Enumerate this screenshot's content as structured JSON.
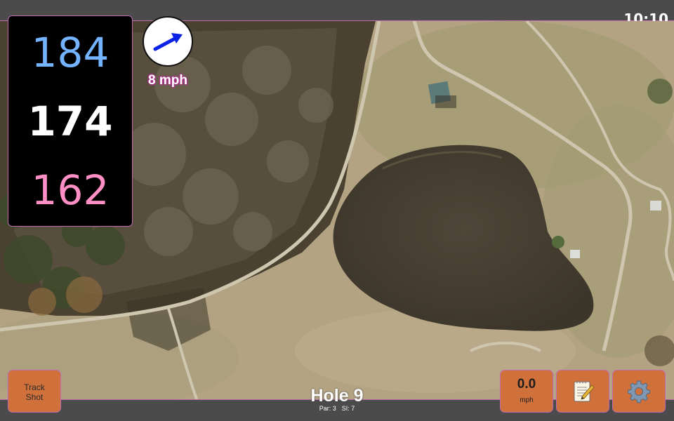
{
  "status": {
    "clock": "10:10"
  },
  "yardages": {
    "back": "184",
    "middle": "174",
    "front": "162"
  },
  "wind": {
    "speed_label": "8 mph",
    "direction_icon": "arrow-icon"
  },
  "hole": {
    "title": "Hole 9",
    "par_label": "Par: 3",
    "si_label": "SI: 7"
  },
  "buttons": {
    "track_shot_line1": "Track",
    "track_shot_line2": "Shot",
    "speed_value": "0.0",
    "speed_unit": "mph",
    "notes_icon": "notepad-icon",
    "settings_icon": "gear-icon"
  },
  "colors": {
    "back_yardage": "#74b3ff",
    "middle_yardage": "#ffffff",
    "front_yardage": "#ff8fc4",
    "button_bg": "#d0703b",
    "accent_border": "#c06bb0"
  }
}
